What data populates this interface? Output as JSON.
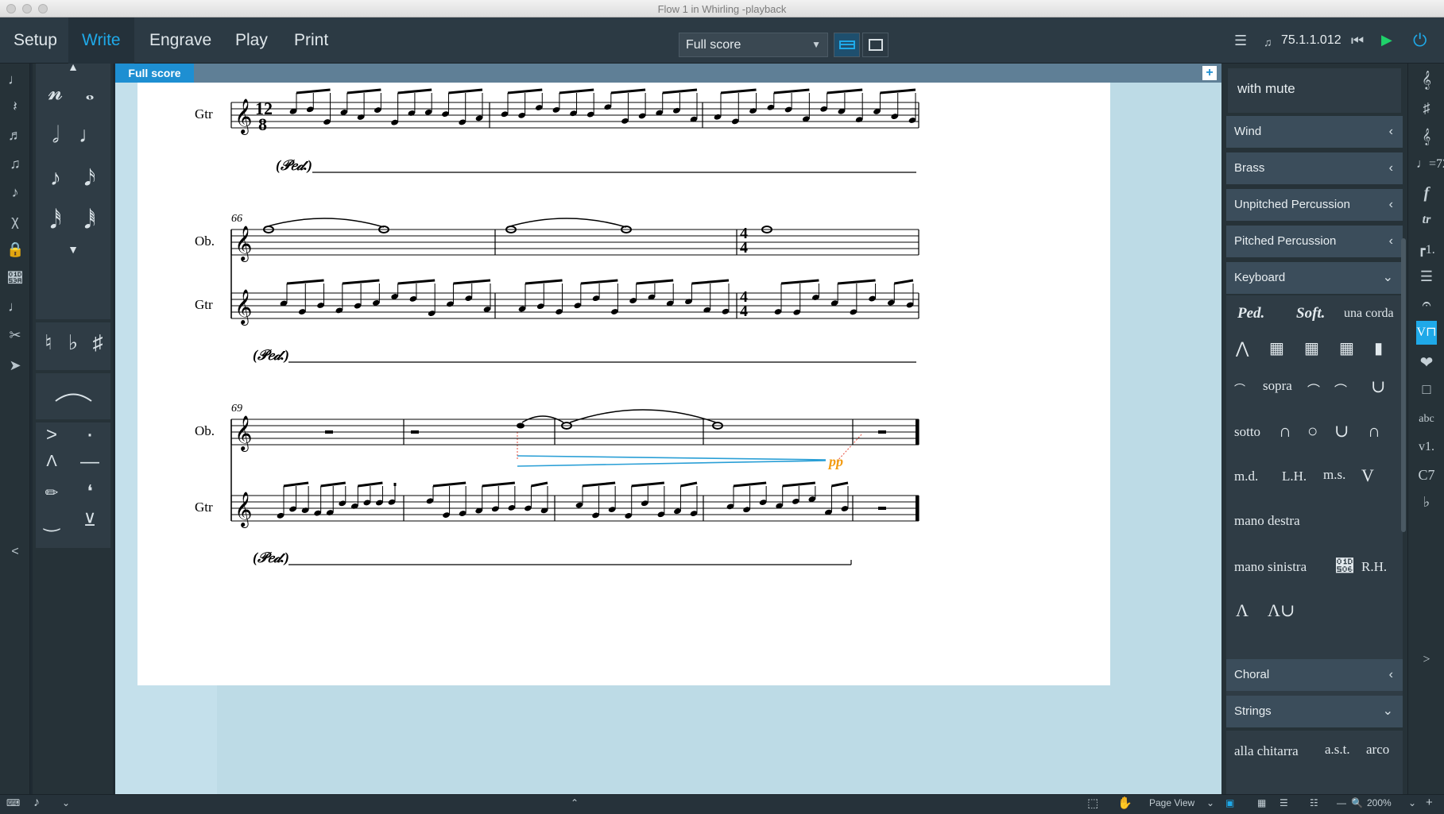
{
  "window": {
    "title": "Flow 1 in Whirling -playback"
  },
  "modes": [
    "Setup",
    "Write",
    "Engrave",
    "Play",
    "Print"
  ],
  "active_mode": "Write",
  "layout_selector": {
    "value": "Full score"
  },
  "transport": {
    "time": "75.1.1.012"
  },
  "tab": {
    "label": "Full score"
  },
  "score": {
    "system1": {
      "instrument": "Gtr",
      "time_signature_top": "12",
      "time_signature_bottom": "8",
      "pedal": "(𝒫𝑒𝒹.)"
    },
    "system2": {
      "bar_number": "66",
      "instruments": [
        "Ob.",
        "Gtr"
      ],
      "time_signature_top": "4",
      "time_signature_bottom": "4",
      "pedal": "(𝒫𝑒𝒹.)"
    },
    "system3": {
      "bar_number": "69",
      "instruments": [
        "Ob.",
        "Gtr"
      ],
      "dynamic": "pp",
      "pedal": "(𝒫𝑒𝒹.)"
    }
  },
  "right_panel": {
    "top_item": "with mute",
    "sections": [
      {
        "label": "Wind",
        "state": "collapsed"
      },
      {
        "label": "Brass",
        "state": "collapsed"
      },
      {
        "label": "Unpitched Percussion",
        "state": "collapsed"
      },
      {
        "label": "Pitched Percussion",
        "state": "collapsed"
      },
      {
        "label": "Keyboard",
        "state": "expanded"
      },
      {
        "label": "Choral",
        "state": "collapsed"
      },
      {
        "label": "Strings",
        "state": "expanded"
      }
    ],
    "keyboard_items": {
      "ped": "Ped.",
      "soft": "Soft.",
      "una_corda": "una corda",
      "sopra": "sopra",
      "sotto": "sotto",
      "md": "m.d.",
      "lh": "L.H.",
      "ms": "m.s.",
      "mano_destra": "mano destra",
      "mano_sinistra": "mano sinistra",
      "rh": "R.H."
    },
    "strings_items": {
      "alla_chitarra": "alla chitarra",
      "ast": "a.s.t.",
      "arco": "arco"
    }
  },
  "right_strip_labels": {
    "abc": "abc",
    "v1": "v1.",
    "c7": "C7"
  },
  "status": {
    "view": "Page View",
    "zoom": "200%"
  },
  "colors": {
    "accent": "#1fa9e8",
    "play": "#1fd16a",
    "dynamic": "#f39c12",
    "hairpin": "#2a9fd6"
  }
}
